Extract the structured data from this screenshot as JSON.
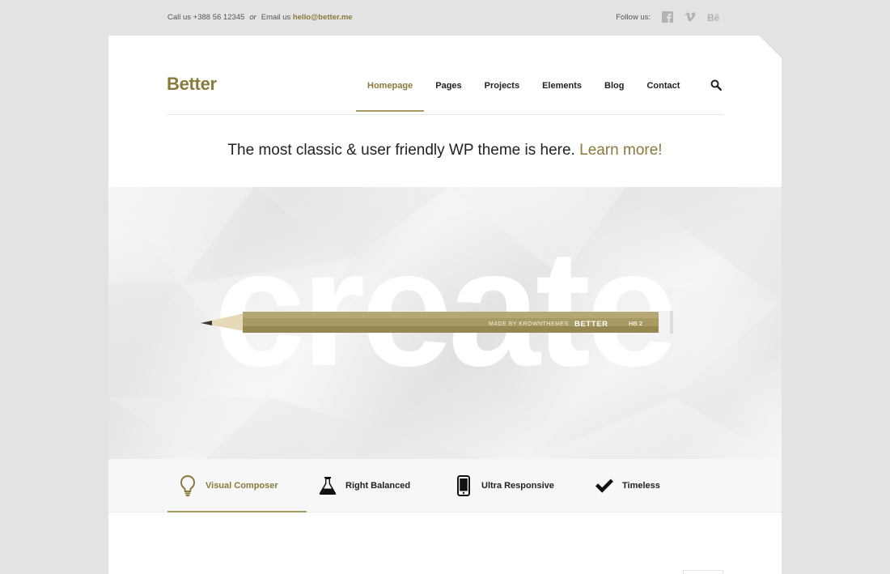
{
  "topbar": {
    "call_label": "Call us +388 56 12345",
    "or_label": "or",
    "email_prefix": "Email us",
    "email": "hello@better.me",
    "follow_label": "Follow us:",
    "social": [
      {
        "icon": "facebook-icon"
      },
      {
        "icon": "vimeo-icon"
      },
      {
        "icon": "behance-icon"
      }
    ]
  },
  "header": {
    "logo": "Better",
    "nav": [
      {
        "label": "Homepage",
        "active": true
      },
      {
        "label": "Pages"
      },
      {
        "label": "Projects"
      },
      {
        "label": "Elements"
      },
      {
        "label": "Blog"
      },
      {
        "label": "Contact"
      }
    ],
    "search_icon": "search-icon"
  },
  "tagline": {
    "text": "The most classic & user friendly WP theme is here.",
    "link": "Learn more!"
  },
  "hero": {
    "word": "create",
    "pencil_maker": "MADE BY KROWNTHEMES",
    "pencil_brand": "BETTER",
    "pencil_grade": "HB 2"
  },
  "features": [
    {
      "label": "Visual Composer",
      "icon": "lightbulb-icon",
      "active": true
    },
    {
      "label": "Right Balanced",
      "icon": "flask-icon"
    },
    {
      "label": "Ultra Responsive",
      "icon": "smartphone-icon"
    },
    {
      "label": "Timeless",
      "icon": "checkmark-icon"
    }
  ],
  "colors": {
    "accent": "#8a7a3c",
    "page_bg": "#e3e3e3",
    "pencil_body": "#a89a63"
  }
}
